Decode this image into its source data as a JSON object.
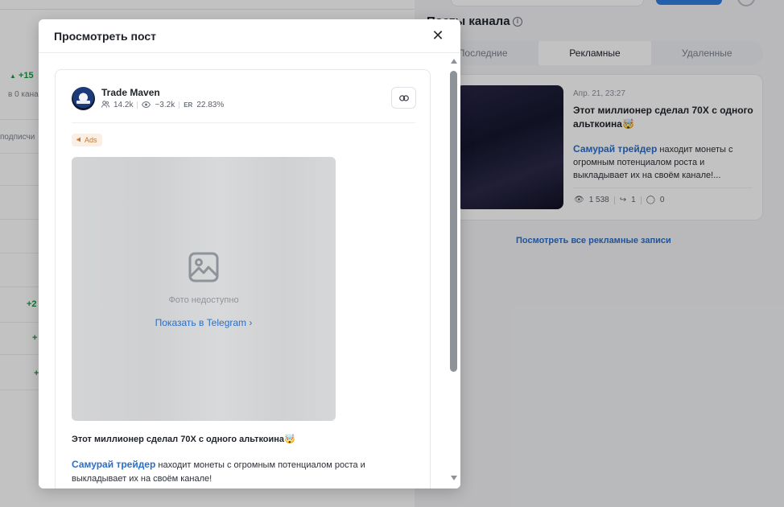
{
  "background": {
    "section_title": "Посты канала",
    "tabs": [
      {
        "label": "Последние",
        "active": false
      },
      {
        "label": "Рекламные",
        "active": true
      },
      {
        "label": "Удаленные",
        "active": false
      }
    ],
    "post": {
      "date": "Апр. 21, 23:27",
      "title": "Этот миллионер сделал 70X с одного альткоина🤯",
      "link_text": "Самурай трейдер",
      "text": " находит монеты с огромным потенциалом роста и выкладывает их на своём канале!...",
      "views": "1 538",
      "shares": "1",
      "comments": "0"
    },
    "view_all_link": "Посмотреть все рекламные записи",
    "left_fragments": {
      "growth_1": "+15",
      "in_channels": "в 0 кана",
      "subscribers": "подписчи",
      "growth_2": "+2",
      "growth_3": "+",
      "growth_4": "+"
    }
  },
  "modal": {
    "title": "Просмотреть пост",
    "close_glyph": "✕",
    "channel": {
      "name": "Trade Maven",
      "subscribers": "14.2k",
      "views": "~3.2k",
      "er_label": "ER",
      "er_value": "22.83%"
    },
    "ads_badge": "Ads",
    "photo": {
      "unavailable_text": "Фото недоступно",
      "telegram_link": "Показать в Telegram ›"
    },
    "post_title": "Этот миллионер сделал 70X с одного альткоина🤯",
    "post_link_text": "Самурай трейдер",
    "post_text": " находит монеты с огромным потенциалом роста и выкладывает их на своём канале!"
  },
  "colors": {
    "accent": "#2a6fc9",
    "growth": "#1e9a46",
    "ads_bg": "#fbefe3",
    "ads_text": "#c0793c"
  }
}
